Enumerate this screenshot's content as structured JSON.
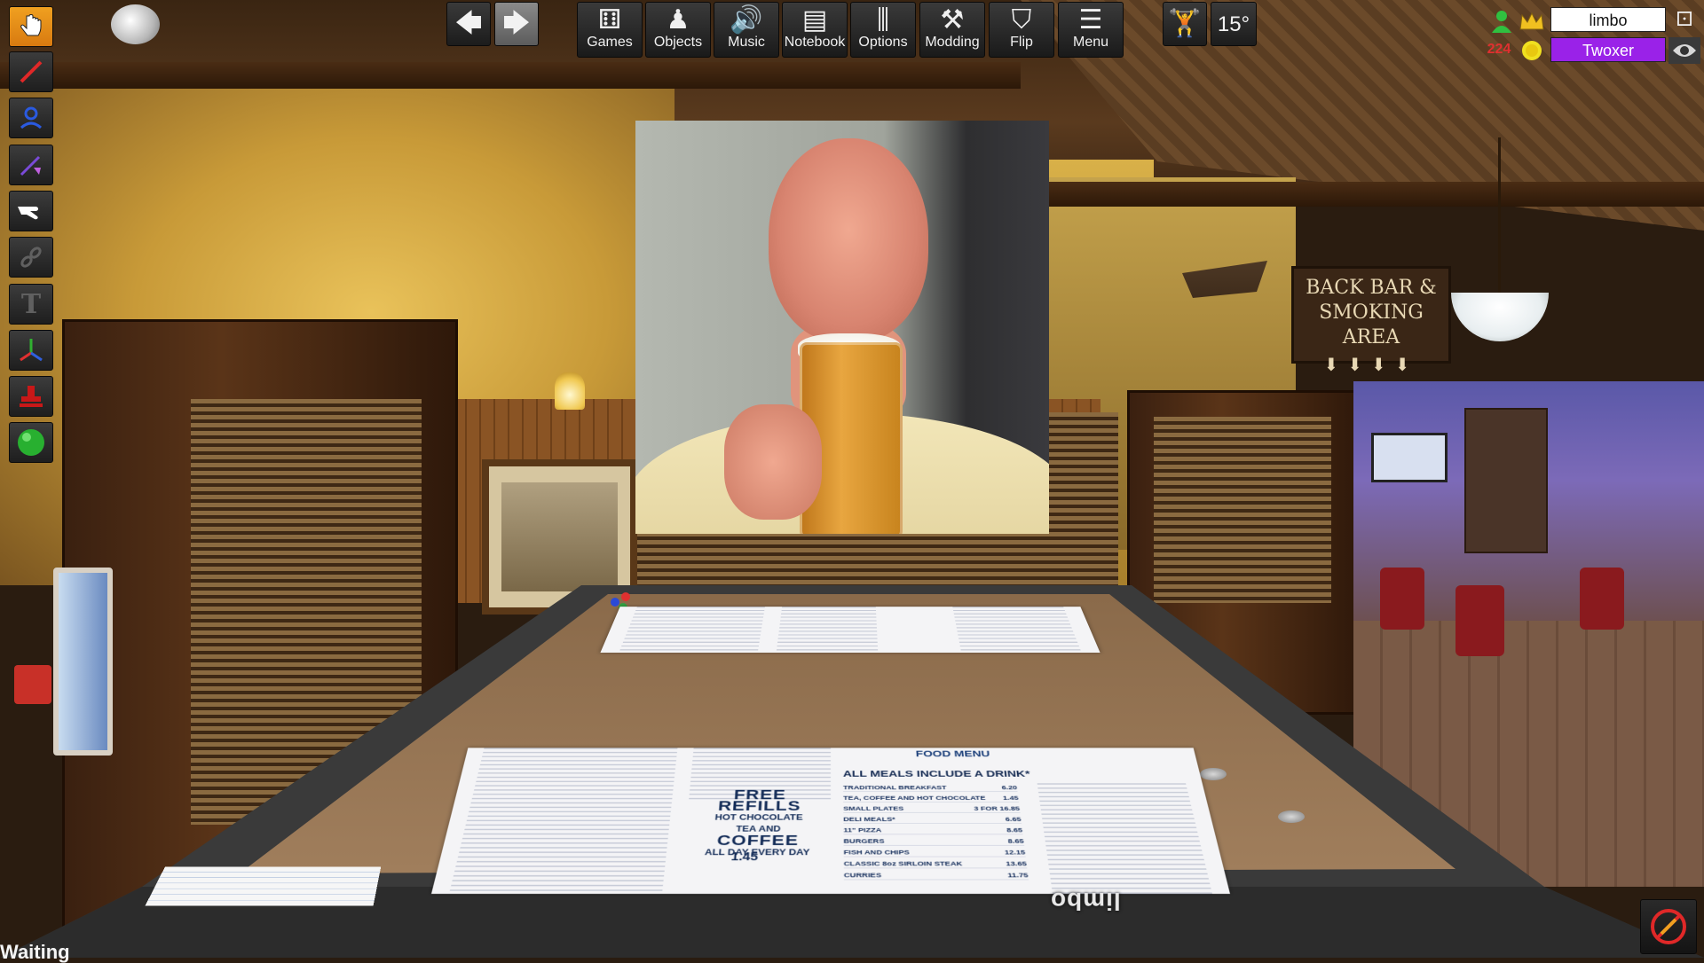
{
  "toolbar": {
    "nav_back_icon": "arrow-left-icon",
    "nav_forward_icon": "arrow-right-icon",
    "buttons": [
      {
        "label": "Games",
        "icon": "dice-icon"
      },
      {
        "label": "Objects",
        "icon": "pawn-icon"
      },
      {
        "label": "Music",
        "icon": "speaker-icon"
      },
      {
        "label": "Notebook",
        "icon": "notebook-icon"
      },
      {
        "label": "Options",
        "icon": "sliders-icon"
      },
      {
        "label": "Modding",
        "icon": "tools-icon"
      },
      {
        "label": "Flip",
        "icon": "flip-table-icon"
      },
      {
        "label": "Menu",
        "icon": "hamburger-icon"
      }
    ],
    "rotation_label": "15°"
  },
  "tools": [
    {
      "name": "grab-tool",
      "icon": "hand-pointer-icon",
      "active": true
    },
    {
      "name": "pen-tool",
      "icon": "pen-icon"
    },
    {
      "name": "zone-tool",
      "icon": "person-zone-icon"
    },
    {
      "name": "line-tool",
      "icon": "line-arrow-icon"
    },
    {
      "name": "flick-tool",
      "icon": "flick-hand-icon"
    },
    {
      "name": "joint-tool",
      "icon": "chain-icon"
    },
    {
      "name": "text-tool",
      "icon": "text-t-icon"
    },
    {
      "name": "gizmo-tool",
      "icon": "axes-icon"
    },
    {
      "name": "snap-tool",
      "icon": "stamp-icon"
    },
    {
      "name": "decal-tool",
      "icon": "green-ball-icon"
    }
  ],
  "players": [
    {
      "name": "limbo",
      "color": "#ffffff",
      "text_color": "#111111",
      "icons": [
        "person-icon",
        "crown-icon"
      ]
    },
    {
      "name": "Twoxer",
      "color": "#9a22e8",
      "text_color": "#ffffff",
      "badge": "224",
      "icons": [
        "coin-icon",
        "eye-icon"
      ]
    }
  ],
  "scene": {
    "sign_line1": "BACK BAR &",
    "sign_line2": "SMOKING AREA",
    "sign_arrows": "⬇⬇⬇⬇",
    "table_owner_label": "limbo",
    "menu_title": "FOOD MENU",
    "menu_banner": "ALL MEALS INCLUDE A DRINK*",
    "menu_refills_line1": "FREE",
    "menu_refills_line2": "REFILLS",
    "menu_refills_line3": "HOT CHOCOLATE",
    "menu_refills_line4": "TEA AND",
    "menu_refills_line5": "COFFEE",
    "menu_refills_line6": "ALL DAY EVERY DAY",
    "menu_refills_price": "1.45",
    "menu_items": [
      {
        "item": "TRADITIONAL BREAKFAST",
        "price": "6.20"
      },
      {
        "item": "TEA, COFFEE AND HOT CHOCOLATE",
        "price": "1.45"
      },
      {
        "item": "SMALL PLATES",
        "price": "3 FOR 16.85"
      },
      {
        "item": "DELI MEALS*",
        "price": "6.65"
      },
      {
        "item": "11\" PIZZA",
        "price": "8.65"
      },
      {
        "item": "BURGERS",
        "price": "8.65"
      },
      {
        "item": "FISH AND CHIPS",
        "price": "12.15"
      },
      {
        "item": "CLASSIC 8oz SIRLOIN STEAK",
        "price": "13.65"
      },
      {
        "item": "CURRIES",
        "price": "11.75"
      }
    ]
  },
  "bottom_text": "Waiting",
  "hud_colors": {
    "active_tool": "#f0a020",
    "twoxer": "#9a22e8",
    "badge": "#e03030"
  }
}
